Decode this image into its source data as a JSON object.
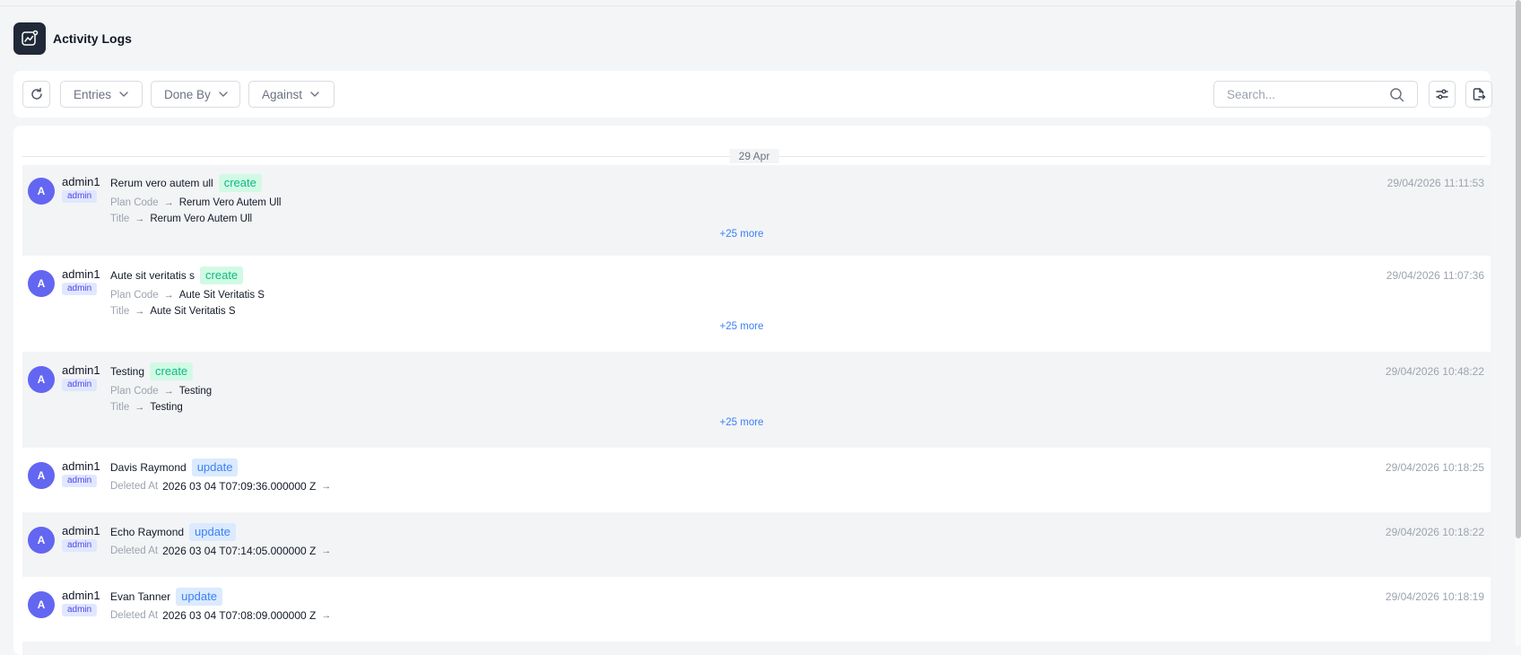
{
  "page": {
    "title": "Activity Logs"
  },
  "toolbar": {
    "filters": [
      {
        "label": "Entries"
      },
      {
        "label": "Done By"
      },
      {
        "label": "Against"
      }
    ],
    "search_placeholder": "Search..."
  },
  "log": {
    "date_label": "29 Apr",
    "entries": [
      {
        "avatar": "A",
        "user": "admin1",
        "role": "admin",
        "title": "Rerum vero autem ull",
        "action": "create",
        "fields": [
          {
            "key": "Plan Code",
            "value": "Rerum Vero Autem Ull"
          },
          {
            "key": "Title",
            "value": "Rerum Vero Autem Ull"
          }
        ],
        "more": "+25 more",
        "time": "29/04/2026 11:11:53"
      },
      {
        "avatar": "A",
        "user": "admin1",
        "role": "admin",
        "title": "Aute sit veritatis s",
        "action": "create",
        "fields": [
          {
            "key": "Plan Code",
            "value": "Aute Sit Veritatis S"
          },
          {
            "key": "Title",
            "value": "Aute Sit Veritatis S"
          }
        ],
        "more": "+25 more",
        "time": "29/04/2026 11:07:36"
      },
      {
        "avatar": "A",
        "user": "admin1",
        "role": "admin",
        "title": "Testing",
        "action": "create",
        "fields": [
          {
            "key": "Plan Code",
            "value": "Testing"
          },
          {
            "key": "Title",
            "value": "Testing"
          }
        ],
        "more": "+25 more",
        "time": "29/04/2026 10:48:22"
      },
      {
        "avatar": "A",
        "user": "admin1",
        "role": "admin",
        "title": "Davis Raymond",
        "action": "update",
        "fields": [
          {
            "key": "Deleted At",
            "value": "2026 03 04 T07:09:36.000000 Z"
          }
        ],
        "time": "29/04/2026 10:18:25"
      },
      {
        "avatar": "A",
        "user": "admin1",
        "role": "admin",
        "title": "Echo Raymond",
        "action": "update",
        "fields": [
          {
            "key": "Deleted At",
            "value": "2026 03 04 T07:14:05.000000 Z"
          }
        ],
        "time": "29/04/2026 10:18:22"
      },
      {
        "avatar": "A",
        "user": "admin1",
        "role": "admin",
        "title": "Evan Tanner",
        "action": "update",
        "fields": [
          {
            "key": "Deleted At",
            "value": "2026 03 04 T07:08:09.000000 Z"
          }
        ],
        "time": "29/04/2026 10:18:19"
      }
    ]
  },
  "icons": {
    "logo": "chart-app-icon",
    "refresh": "refresh-icon",
    "chevron": "chevron-down-icon",
    "search": "search-icon",
    "settings": "sliders-icon",
    "export": "export-icon",
    "arrow": "arrow-right-icon"
  },
  "colors": {
    "avatar": "#6366f1",
    "create_badge": "#10b981",
    "update_badge": "#3b82f6",
    "logo_bg": "#1f2937"
  }
}
